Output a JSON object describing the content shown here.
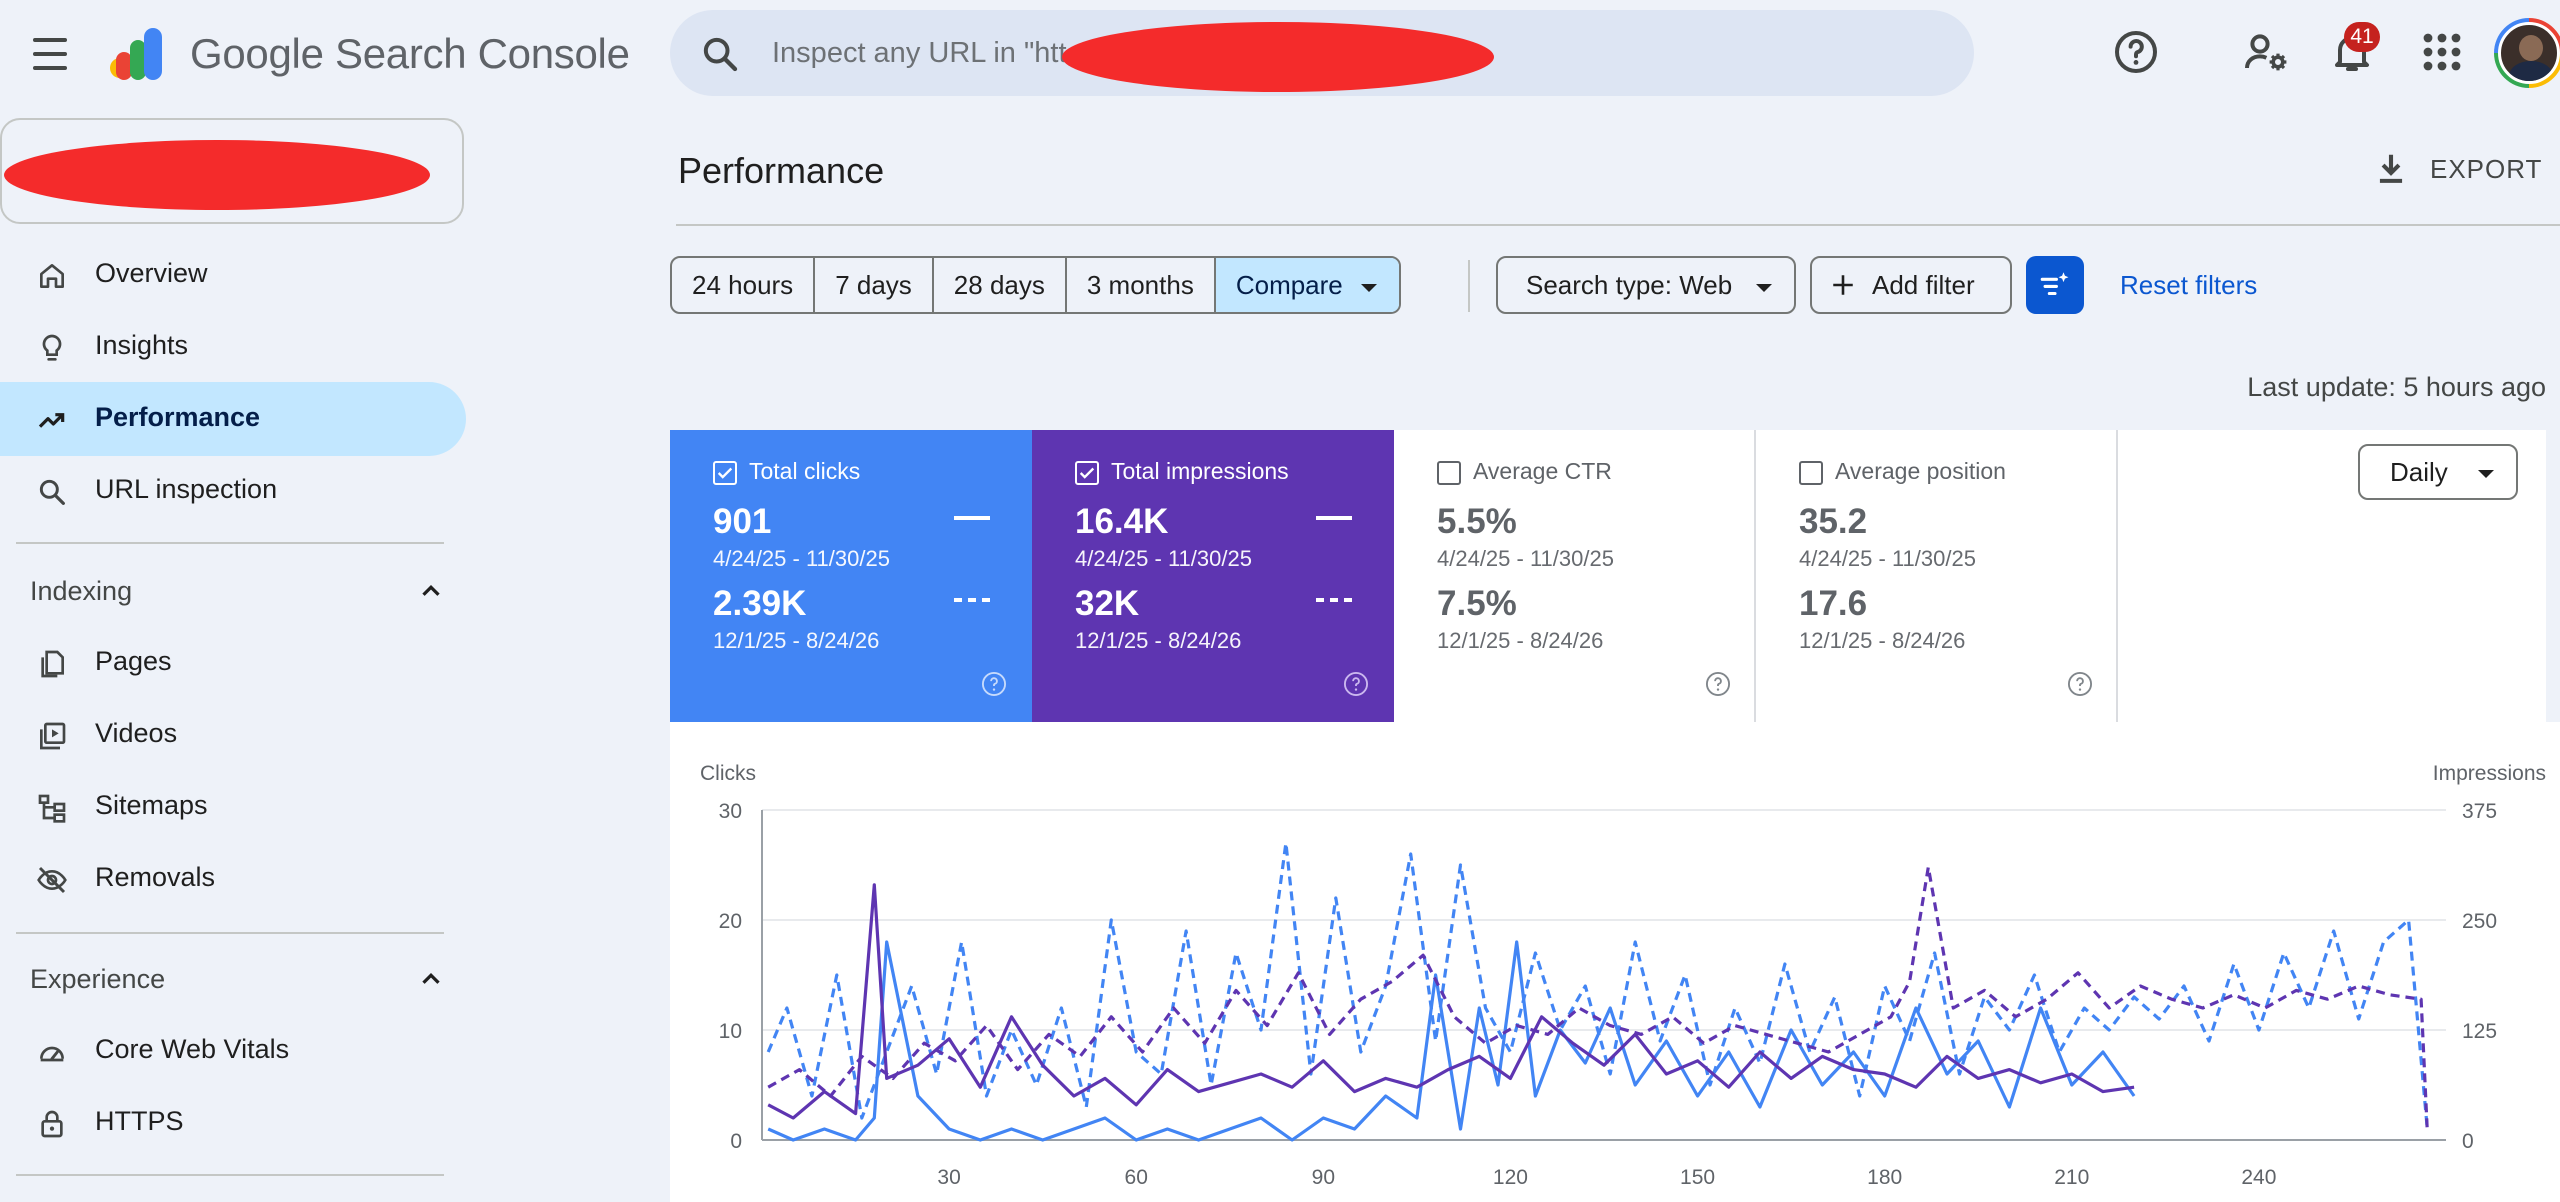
{
  "header": {
    "app_title": "Google Search Console",
    "search_placeholder": "Inspect any URL in \"htt",
    "notification_count": "41"
  },
  "sidebar": {
    "items": [
      {
        "label": "Overview",
        "icon": "home-icon"
      },
      {
        "label": "Insights",
        "icon": "lightbulb-icon"
      },
      {
        "label": "Performance",
        "icon": "trending-up-icon",
        "active": true
      },
      {
        "label": "URL inspection",
        "icon": "search-icon"
      }
    ],
    "sections": [
      {
        "title": "Indexing",
        "items": [
          {
            "label": "Pages",
            "icon": "pages-icon"
          },
          {
            "label": "Videos",
            "icon": "video-icon"
          },
          {
            "label": "Sitemaps",
            "icon": "sitemap-icon"
          },
          {
            "label": "Removals",
            "icon": "eye-off-icon"
          }
        ]
      },
      {
        "title": "Experience",
        "items": [
          {
            "label": "Core Web Vitals",
            "icon": "gauge-icon"
          },
          {
            "label": "HTTPS",
            "icon": "lock-icon"
          }
        ]
      }
    ]
  },
  "main": {
    "title": "Performance",
    "export_label": "EXPORT",
    "date_ranges": [
      "24 hours",
      "7 days",
      "28 days",
      "3 months",
      "Compare"
    ],
    "search_type": "Search type: Web",
    "add_filter": "Add filter",
    "reset_filters": "Reset filters",
    "last_update": "Last update: 5 hours ago",
    "granularity": "Daily"
  },
  "metrics": [
    {
      "label": "Total clicks",
      "checked": true,
      "value1": "901",
      "range1": "4/24/25 - 11/30/25",
      "value2": "2.39K",
      "range2": "12/1/25 - 8/24/26",
      "color": "#4285f4"
    },
    {
      "label": "Total impressions",
      "checked": true,
      "value1": "16.4K",
      "range1": "4/24/25 - 11/30/25",
      "value2": "32K",
      "range2": "12/1/25 - 8/24/26",
      "color": "#5e35b1"
    },
    {
      "label": "Average CTR",
      "checked": false,
      "value1": "5.5%",
      "range1": "4/24/25 - 11/30/25",
      "value2": "7.5%",
      "range2": "12/1/25 - 8/24/26",
      "color": "#ffffff"
    },
    {
      "label": "Average position",
      "checked": false,
      "value1": "35.2",
      "range1": "4/24/25 - 11/30/25",
      "value2": "17.6",
      "range2": "12/1/25 - 8/24/26",
      "color": "#ffffff"
    }
  ],
  "chart_data": {
    "type": "line",
    "ylabel_left": "Clicks",
    "ylabel_right": "Impressions",
    "ylim_left": [
      0,
      30
    ],
    "ylim_right": [
      0,
      375
    ],
    "y_ticks_left": [
      "30",
      "20",
      "10",
      "0"
    ],
    "y_ticks_right": [
      "375",
      "250",
      "125",
      "0"
    ],
    "x_ticks": [
      "30",
      "60",
      "90",
      "120",
      "150",
      "180",
      "210",
      "240"
    ],
    "xlim": [
      0,
      270
    ],
    "grid": true,
    "series": [
      {
        "axis": "left",
        "metric": "Total clicks",
        "period": "4/24/25 - 11/30/25",
        "style": "solid",
        "color": "#4285f4",
        "x": [
          1,
          5,
          10,
          15,
          18,
          20,
          25,
          30,
          35,
          40,
          45,
          50,
          55,
          60,
          65,
          70,
          75,
          80,
          85,
          90,
          95,
          100,
          105,
          108,
          112,
          115,
          118,
          121,
          124,
          128,
          132,
          136,
          140,
          145,
          150,
          155,
          160,
          165,
          170,
          175,
          180,
          185,
          190,
          195,
          200,
          205,
          210,
          215,
          220
        ],
        "y": [
          1,
          0,
          1,
          0,
          2,
          18,
          4,
          1,
          0,
          1,
          0,
          1,
          2,
          0,
          1,
          0,
          1,
          2,
          0,
          2,
          1,
          4,
          2,
          15,
          1,
          12,
          5,
          18,
          4,
          10,
          7,
          12,
          5,
          9,
          4,
          8,
          3,
          10,
          5,
          8,
          4,
          12,
          6,
          9,
          3,
          12,
          5,
          8,
          4
        ]
      },
      {
        "axis": "left",
        "metric": "Total clicks",
        "period": "12/1/25 - 8/24/26",
        "style": "dashed",
        "color": "#4285f4",
        "x": [
          1,
          4,
          8,
          12,
          16,
          20,
          24,
          28,
          32,
          36,
          40,
          44,
          48,
          52,
          56,
          60,
          64,
          68,
          72,
          76,
          80,
          84,
          88,
          92,
          96,
          100,
          104,
          108,
          112,
          116,
          120,
          124,
          128,
          132,
          136,
          140,
          144,
          148,
          152,
          156,
          160,
          164,
          168,
          172,
          176,
          180,
          184,
          188,
          192,
          196,
          200,
          204,
          208,
          212,
          216,
          220,
          224,
          228,
          232,
          236,
          240,
          244,
          248,
          252,
          256,
          260,
          264,
          267
        ],
        "y": [
          8,
          12,
          4,
          15,
          2,
          8,
          14,
          6,
          18,
          4,
          10,
          5,
          12,
          3,
          20,
          8,
          6,
          19,
          5,
          17,
          10,
          27,
          6,
          22,
          8,
          14,
          26,
          9,
          25,
          12,
          8,
          17,
          10,
          14,
          6,
          18,
          9,
          15,
          5,
          12,
          7,
          16,
          8,
          13,
          4,
          14,
          9,
          17,
          6,
          13,
          10,
          15,
          8,
          12,
          10,
          13,
          11,
          14,
          9,
          16,
          10,
          17,
          12,
          19,
          11,
          18,
          20,
          1
        ]
      },
      {
        "axis": "right",
        "metric": "Total impressions",
        "period": "4/24/25 - 11/30/25",
        "style": "solid",
        "color": "#5e35b1",
        "x": [
          1,
          5,
          10,
          15,
          18,
          20,
          25,
          30,
          35,
          40,
          45,
          50,
          55,
          60,
          65,
          70,
          75,
          80,
          85,
          90,
          95,
          100,
          105,
          110,
          115,
          120,
          125,
          130,
          135,
          140,
          145,
          150,
          155,
          160,
          165,
          170,
          175,
          180,
          185,
          190,
          195,
          200,
          205,
          210,
          215,
          220
        ],
        "y": [
          40,
          25,
          55,
          30,
          290,
          70,
          85,
          115,
          60,
          140,
          85,
          50,
          70,
          40,
          80,
          55,
          65,
          75,
          60,
          90,
          55,
          70,
          60,
          80,
          95,
          70,
          140,
          110,
          85,
          120,
          75,
          90,
          60,
          100,
          70,
          95,
          80,
          75,
          60,
          95,
          70,
          80,
          65,
          75,
          55,
          60
        ]
      },
      {
        "axis": "right",
        "metric": "Total impressions",
        "period": "12/1/25 - 8/24/26",
        "style": "dashed",
        "color": "#5e35b1",
        "x": [
          1,
          6,
          11,
          16,
          21,
          26,
          31,
          36,
          41,
          46,
          51,
          56,
          61,
          66,
          71,
          76,
          81,
          86,
          91,
          96,
          101,
          106,
          111,
          116,
          121,
          126,
          131,
          136,
          141,
          146,
          151,
          156,
          161,
          166,
          171,
          176,
          181,
          184,
          187,
          191,
          196,
          201,
          206,
          211,
          216,
          221,
          226,
          231,
          236,
          241,
          246,
          251,
          256,
          261,
          266,
          267
        ],
        "y": [
          60,
          80,
          50,
          95,
          70,
          110,
          90,
          130,
          80,
          120,
          95,
          140,
          100,
          150,
          110,
          170,
          130,
          190,
          120,
          160,
          180,
          210,
          140,
          110,
          130,
          120,
          150,
          130,
          120,
          140,
          110,
          130,
          120,
          110,
          100,
          120,
          140,
          180,
          310,
          150,
          170,
          140,
          160,
          190,
          150,
          175,
          160,
          150,
          165,
          150,
          170,
          160,
          175,
          165,
          160,
          10
        ]
      }
    ]
  }
}
